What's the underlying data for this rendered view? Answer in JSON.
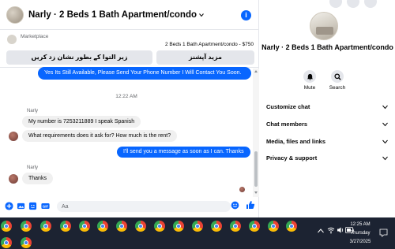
{
  "chat": {
    "title": "Narly · 2 Beds 1 Bath Apartment/condo",
    "info_icon": "info-icon",
    "marketplace_label": "Marketplace",
    "listing": "2 Beds 1 Bath Apartment/condo - $750",
    "quick_replies": [
      "زیر التوا کے بطور نشان زد کریں",
      "مزید آپشنز"
    ],
    "messages": {
      "out1": "Yes Its Still Available, Please Send Your Phone Number I Will Contact You Soon.",
      "time": "12:22 AM",
      "sender1": "Narly",
      "in1": "My number is 7253211889 I speak Spanish",
      "in2": "What requirements does it ask for? How much is the rent?",
      "out2": "I'll send you a message as soon as I can. Thanks",
      "sender2": "Narly",
      "in3": "Thanks"
    },
    "composer_placeholder": "Aa"
  },
  "info": {
    "title": "Narly · 2 Beds 1 Bath Apartment/condo",
    "actions": [
      {
        "label": "Mute",
        "icon": "bell-icon"
      },
      {
        "label": "Search",
        "icon": "search-icon"
      }
    ],
    "menu": [
      "Customize chat",
      "Chat members",
      "Media, files and links",
      "Privacy & support"
    ]
  },
  "taskbar": {
    "time": "12:25 AM",
    "day": "Thursday",
    "date": "3/27/2025",
    "colors": {
      "bg": "#1c2332",
      "chrome_red": "#ea4335",
      "chrome_yellow": "#fbbc05",
      "chrome_green": "#34a853",
      "chrome_blue": "#4285f4"
    }
  },
  "colors": {
    "accent": "#0866ff",
    "bubble_in": "#f0f0f0"
  }
}
